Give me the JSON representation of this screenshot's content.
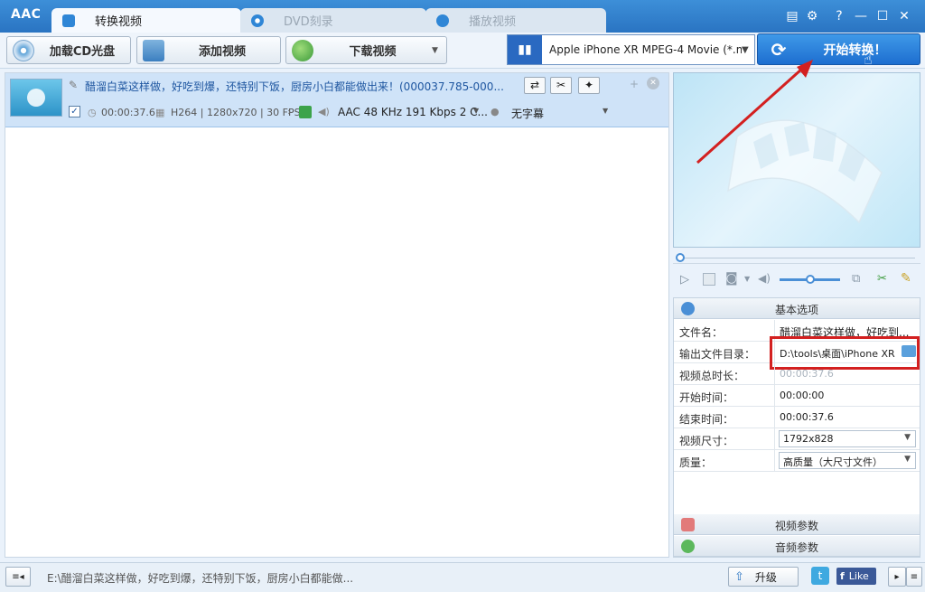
{
  "app": {
    "logo": "AAC",
    "tabs": [
      {
        "label": "转换视频",
        "active": true
      },
      {
        "label": "DVD刻录",
        "active": false
      },
      {
        "label": "播放视频",
        "active": false
      }
    ]
  },
  "toolbar": {
    "load_cd": "加载CD光盘",
    "add_video": "添加视频",
    "download_video": "下载视频",
    "profile": "Apple iPhone XR MPEG-4 Movie (*.m...",
    "convert": "开始转换！"
  },
  "file": {
    "name": "醋溜白菜这样做，好吃到爆，还特别下饭，厨房小白都能做出来！(000037.785-000...",
    "duration": "00:00:37.6",
    "video_info": "H264 | 1280x720 | 30 FPS",
    "audio": "AAC 48 KHz 191 Kbps 2 C...",
    "subtitle": "无字幕"
  },
  "props": {
    "basic_title": "基本选项",
    "rows": [
      {
        "label": "文件名：",
        "value": "醋溜白菜这样做，好吃到..."
      },
      {
        "label": "输出文件目录：",
        "value": "D:\\tools\\桌面\\iPhone XR"
      },
      {
        "label": "视频总时长：",
        "value": "00:00:37.6"
      },
      {
        "label": "开始时间：",
        "value": "00:00:00"
      },
      {
        "label": "结束时间：",
        "value": "00:00:37.6"
      },
      {
        "label": "视频尺寸：",
        "value": "1792x828"
      },
      {
        "label": "质量：",
        "value": "高质量（大尺寸文件）"
      }
    ],
    "video_params": "视频参数",
    "audio_params": "音频参数"
  },
  "status": {
    "path": "E:\\醋溜白菜这样做，好吃到爆，还特别下饭，厨房小白都能做...",
    "upgrade": "升级",
    "like": "Like"
  },
  "colors": {
    "title_bar": "#2a74c2",
    "highlight_box": "#d32020",
    "arrow": "#d32020",
    "row_selected": "#cfe3f8"
  }
}
